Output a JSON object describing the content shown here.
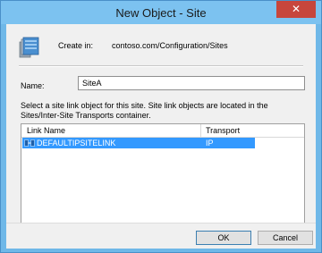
{
  "window": {
    "title": "New Object - Site",
    "close_glyph": "✕"
  },
  "header": {
    "create_in_label": "Create in:",
    "create_in_value": "contoso.com/Configuration/Sites",
    "icon": "site-folder-icon"
  },
  "form": {
    "name_label": "Name:",
    "name_value": "SiteA",
    "description": "Select a site link object for this site. Site link objects are located in the Sites/Inter-Site Transports container."
  },
  "site_links": {
    "columns": [
      "Link Name",
      "Transport"
    ],
    "rows": [
      {
        "name": "DEFAULTIPSITELINK",
        "transport": "IP",
        "selected": true
      }
    ]
  },
  "buttons": {
    "ok": "OK",
    "cancel": "Cancel"
  },
  "colors": {
    "frame": "#6fb8e8",
    "selection": "#3399ff",
    "close": "#c7463c"
  }
}
